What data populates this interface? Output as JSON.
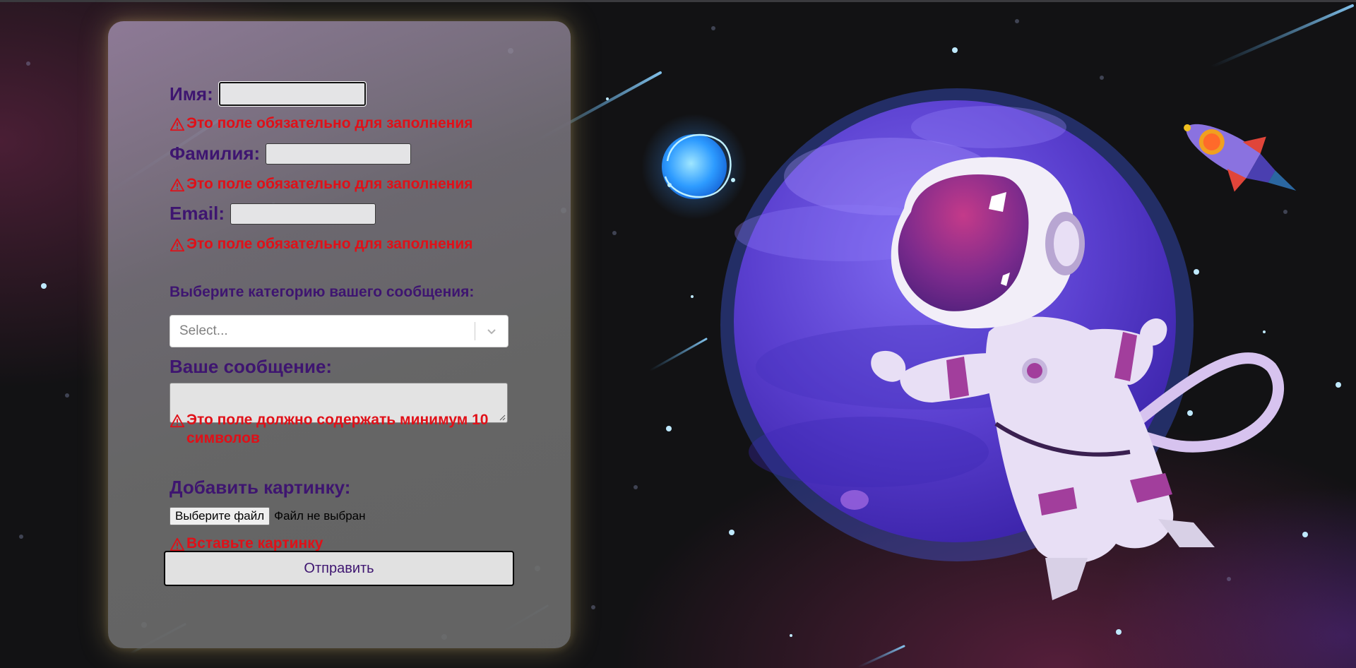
{
  "form": {
    "first_name_label": "Имя:",
    "first_name_value": "",
    "first_name_error": "Это поле обязательно для заполнения",
    "last_name_label": "Фамилия:",
    "last_name_value": "",
    "last_name_error": "Это поле обязательно для заполнения",
    "email_label": "Email:",
    "email_value": "",
    "email_error": "Это поле обязательно для заполнения",
    "category_label": "Выберите категорию вашего сообщения:",
    "category_placeholder": "Select...",
    "message_label": "Ваше сообщение:",
    "message_value": "",
    "message_error": "Это поле должно содержать минимум 10 символов",
    "image_label": "Добавить картинку:",
    "file_button_label": "Выберите файл",
    "file_status": "Файл не выбран",
    "image_error": "Вставьте картинку",
    "submit_label": "Отправить"
  },
  "colors": {
    "label": "#3e1570",
    "error": "#e01018",
    "background": "#121214",
    "planet": "#6a4fd6",
    "accent_glow": "#e6c878"
  },
  "icons": {
    "warning": "warning-triangle-icon",
    "select": "chevron-down-icon"
  }
}
